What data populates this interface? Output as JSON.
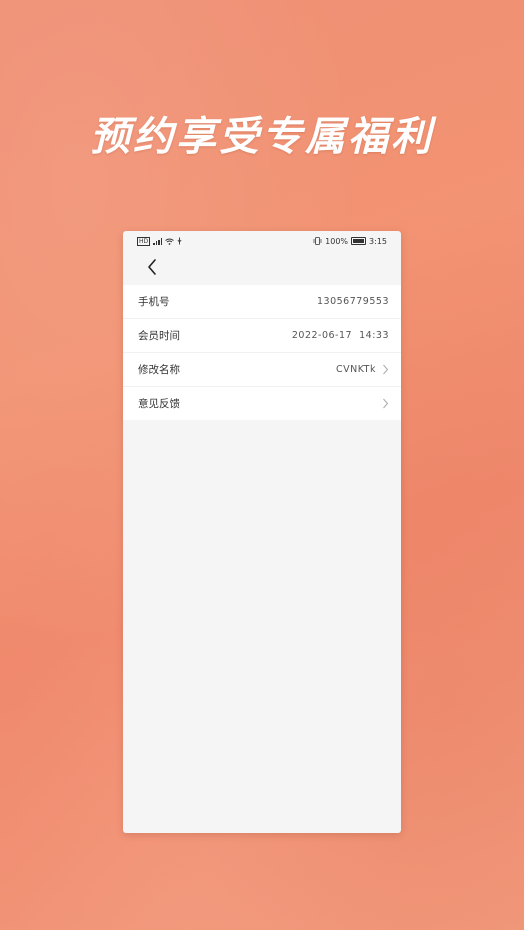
{
  "promo": {
    "title": "预约享受专属福利"
  },
  "status_bar": {
    "left_badge": "HD",
    "battery": "100%",
    "time": "3:15"
  },
  "nav": {
    "back_icon": "chevron-left-icon"
  },
  "profile": {
    "rows": [
      {
        "label": "手机号",
        "value": "13056779553",
        "arrow": false
      },
      {
        "label": "会员时间",
        "value": "2022-06-17  14:33",
        "arrow": false
      },
      {
        "label": "修改名称",
        "value": "CVNKTk",
        "arrow": true
      },
      {
        "label": "意见反馈",
        "value": "",
        "arrow": true
      }
    ]
  },
  "colors": {
    "background": "#f29373",
    "card": "#f5f5f5",
    "list": "#ffffff"
  }
}
